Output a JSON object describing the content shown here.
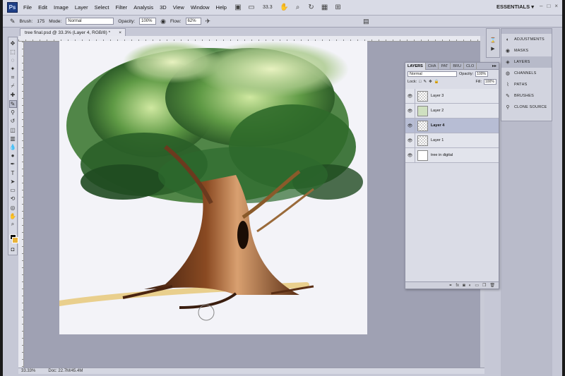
{
  "menubar": {
    "logo": "Ps",
    "items": [
      "File",
      "Edit",
      "Image",
      "Layer",
      "Select",
      "Filter",
      "Analysis",
      "3D",
      "View",
      "Window",
      "Help"
    ],
    "zoom": "33.3",
    "workspace": "ESSENTIALS ▾",
    "window_controls": [
      "–",
      "□",
      "×"
    ]
  },
  "options": {
    "brush_label": "Brush:",
    "brush_size": "175",
    "mode_label": "Mode:",
    "mode_value": "Normal",
    "opacity_label": "Opacity:",
    "opacity_value": "100%",
    "flow_label": "Flow:",
    "flow_value": "62%"
  },
  "document": {
    "tab_title": "tree final.psd @ 33.3% (Layer 4, RGB/8) *",
    "tab_close": "×",
    "status_zoom": "33.33%",
    "status_doc": "Doc: 22.7M/45.4M"
  },
  "layers_panel": {
    "tabs": [
      "LAYERS",
      "CHA",
      "PAT",
      "BRU",
      "CLO"
    ],
    "blend_mode": "Normal",
    "opacity_label": "Opacity:",
    "opacity_value": "100%",
    "lock_label": "Lock:",
    "fill_label": "Fill:",
    "fill_value": "100%",
    "layers": [
      {
        "name": "Layer 3",
        "selected": false
      },
      {
        "name": "Layer 2",
        "selected": false
      },
      {
        "name": "Layer 4",
        "selected": true
      },
      {
        "name": "Layer 1",
        "selected": false
      },
      {
        "name": "tree in digital",
        "selected": false
      }
    ],
    "footer_icons": [
      "link-icon",
      "fx-icon",
      "mask-icon",
      "adjustment-icon",
      "group-icon",
      "new-layer-icon",
      "trash-icon"
    ]
  },
  "dock": {
    "items": [
      {
        "label": "ADJUSTMENTS",
        "active": false
      },
      {
        "label": "MASKS",
        "active": false
      },
      {
        "label": "LAYERS",
        "active": true
      },
      {
        "label": "CHANNELS",
        "active": false
      },
      {
        "label": "PATHS",
        "active": false
      },
      {
        "label": "BRUSHES",
        "active": false
      },
      {
        "label": "CLONE SOURCE",
        "active": false
      }
    ]
  },
  "colors": {
    "foreground": "#111111",
    "background": "#e8b23a",
    "foliage": "#2f6a2a",
    "trunk": "#6b3a1e"
  }
}
